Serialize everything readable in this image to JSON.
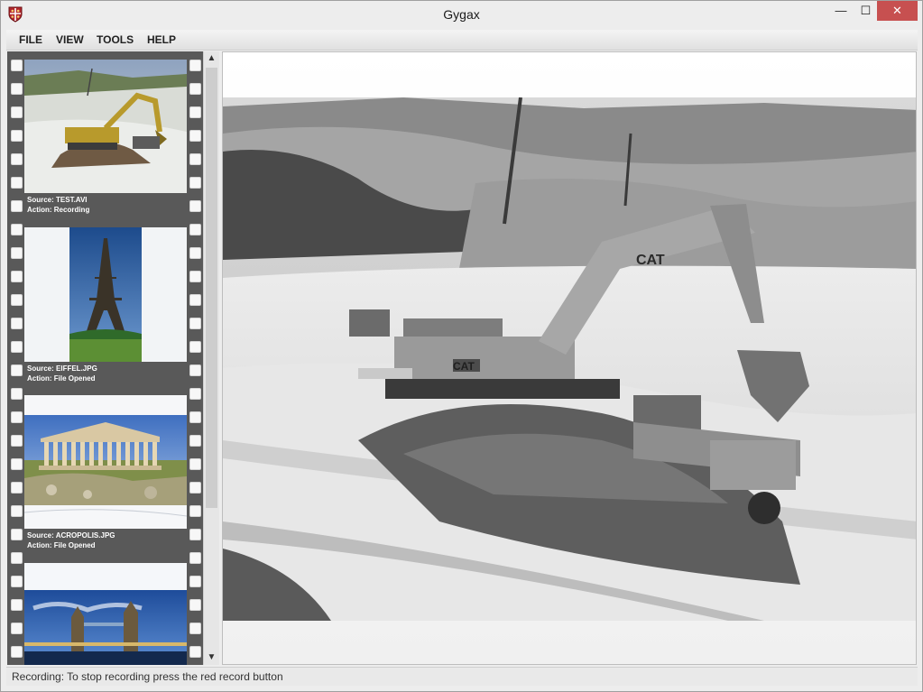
{
  "window": {
    "title": "Gygax",
    "controls": {
      "minimize": "—",
      "maximize": "☐",
      "close": "✕"
    }
  },
  "menu": [
    "FILE",
    "VIEW",
    "TOOLS",
    "HELP"
  ],
  "filmstrip": {
    "items": [
      {
        "source": "Source: TEST.AVI",
        "action": "Action: Recording",
        "image": "excavator-icon"
      },
      {
        "source": "Source: EIFFEL.JPG",
        "action": "Action: File Opened",
        "image": "eiffel-tower-icon"
      },
      {
        "source": "Source: ACROPOLIS.JPG",
        "action": "Action: File Opened",
        "image": "acropolis-icon"
      },
      {
        "source": "",
        "action": "",
        "image": "tower-bridge-icon"
      }
    ]
  },
  "scrollbar": {
    "up": "▲",
    "down": "▼"
  },
  "viewer": {
    "image": "excavator-grayscale-frame"
  },
  "status": {
    "text": "Recording: To stop recording press the red record button"
  },
  "colors": {
    "close_button": "#c75050",
    "filmstrip": "#595959",
    "app_icon": "#b3262b"
  }
}
